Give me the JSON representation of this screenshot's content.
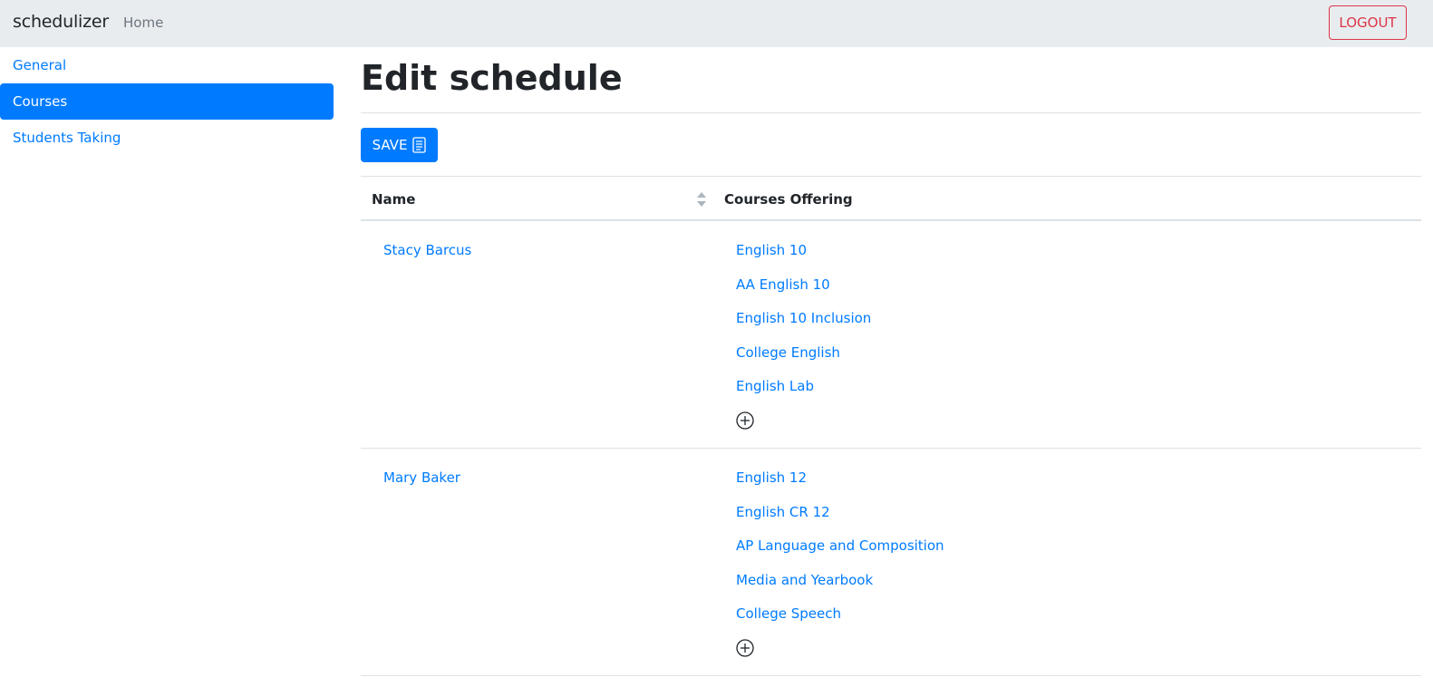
{
  "navbar": {
    "brand": "schedulizer",
    "home": "Home",
    "logout": "LOGOUT"
  },
  "sidebar": {
    "items": [
      {
        "label": "General",
        "active": false
      },
      {
        "label": "Courses",
        "active": true
      },
      {
        "label": "Students Taking",
        "active": false
      }
    ]
  },
  "main": {
    "title": "Edit schedule",
    "save_label": "SAVE"
  },
  "table": {
    "columns": [
      "Name",
      "Courses Offering"
    ],
    "rows": [
      {
        "name": "Stacy Barcus",
        "courses": [
          "English 10",
          "AA English 10",
          "English 10 Inclusion",
          "College English",
          "English Lab"
        ]
      },
      {
        "name": "Mary Baker",
        "courses": [
          "English 12",
          "English CR 12",
          "AP Language and Composition",
          "Media and Yearbook",
          "College Speech"
        ]
      }
    ]
  },
  "colors": {
    "primary": "#007bff",
    "danger": "#dc3545",
    "navbar_bg": "#e9ecef"
  },
  "icons": {
    "save": "document-icon",
    "add": "circle-plus-icon",
    "sort": "sort-icon"
  }
}
